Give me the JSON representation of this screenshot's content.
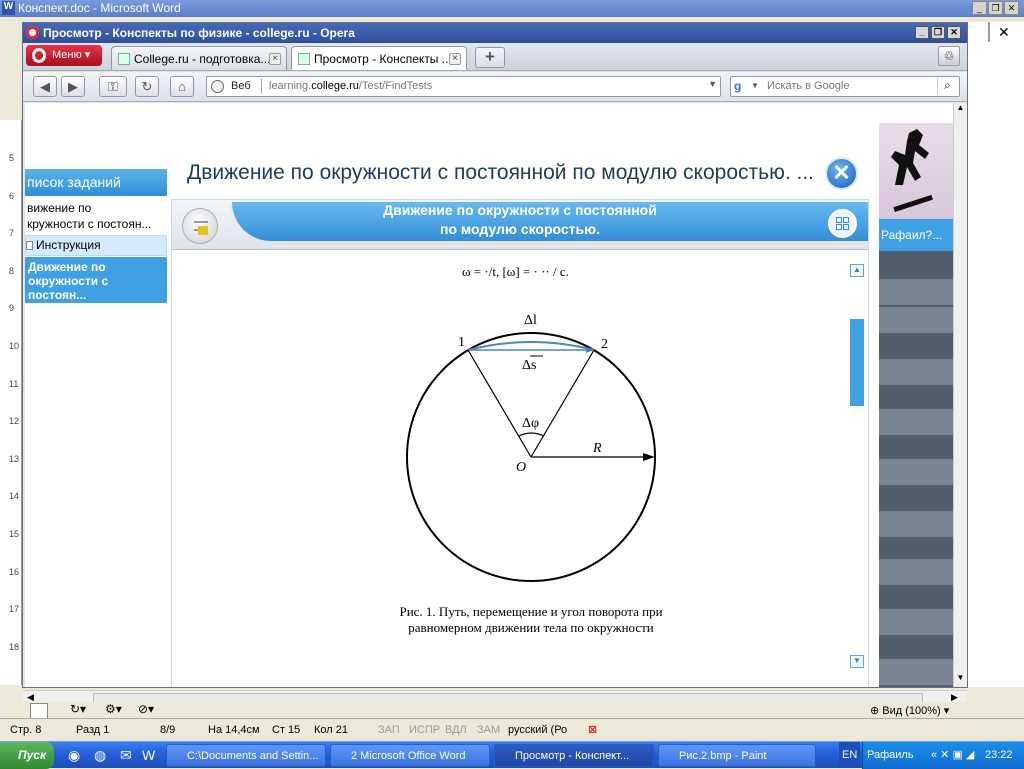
{
  "word": {
    "title": "Конспект.doc - Microsoft Word"
  },
  "opera": {
    "title": "Просмотр - Конспекты по физике - college.ru - Opera",
    "menu_label": "Меню",
    "tabs": [
      {
        "label": "College.ru - подготовка..."
      },
      {
        "label": "Просмотр - Конспекты ..."
      }
    ],
    "address": {
      "prefix": "Веб",
      "url_pre": "learning.",
      "url_domain": "college.ru",
      "url_path": "/Test/FindTests"
    },
    "search_placeholder": "Искать в Google"
  },
  "page": {
    "title": "Движение по окружности с постоянной по модулю скоростью. ...",
    "sidebar": {
      "header": "писок заданий",
      "task": "вижение по\nкружности с постоян...",
      "instruction": "Инструкция",
      "active": "Движение по\nокружности с\nпостоян..."
    },
    "panel_title_1": "Движение по окружности с постоянной",
    "panel_title_2": "по модулю скоростью.",
    "right_user": "Рафаил?...",
    "figure": {
      "formula": "ω = ·/t,  [ω] = ·  ·· / с.",
      "label_1": "1",
      "label_2": "2",
      "label_dl": "Δl",
      "label_ds": "Δs",
      "label_dphi": "Δφ",
      "label_R": "R",
      "label_O": "O",
      "caption_1": "Рис. 1. Путь, перемещение и угол поворота при",
      "caption_2": "равномерном движении тела по окружности"
    }
  },
  "statusbar": {
    "page": "Стр. 8",
    "section": "Разд 1",
    "pages": "8/9",
    "at": "На 14,4см",
    "line": "Ст 15",
    "col": "Кол 21",
    "rec": "ЗАП",
    "trk": "ИСПР",
    "ext": "ВДЛ",
    "ovr": "ЗАМ",
    "lang": "русский (Ро",
    "view": "Вид (100%)"
  },
  "taskbar": {
    "start": "Пуск",
    "items": [
      {
        "label": "C:\\Documents and Settin..."
      },
      {
        "label": "2 Microsoft Office Word"
      },
      {
        "label": "Просмотр - Конспект..."
      },
      {
        "label": "Рис.2.bmp - Paint"
      }
    ],
    "lang": "EN",
    "user": "Рафаиль",
    "time": "23:22"
  },
  "colors": {
    "accent": "#3fa1e3",
    "title_blue": "#1c3d5e",
    "chord": "#4a86c8"
  }
}
